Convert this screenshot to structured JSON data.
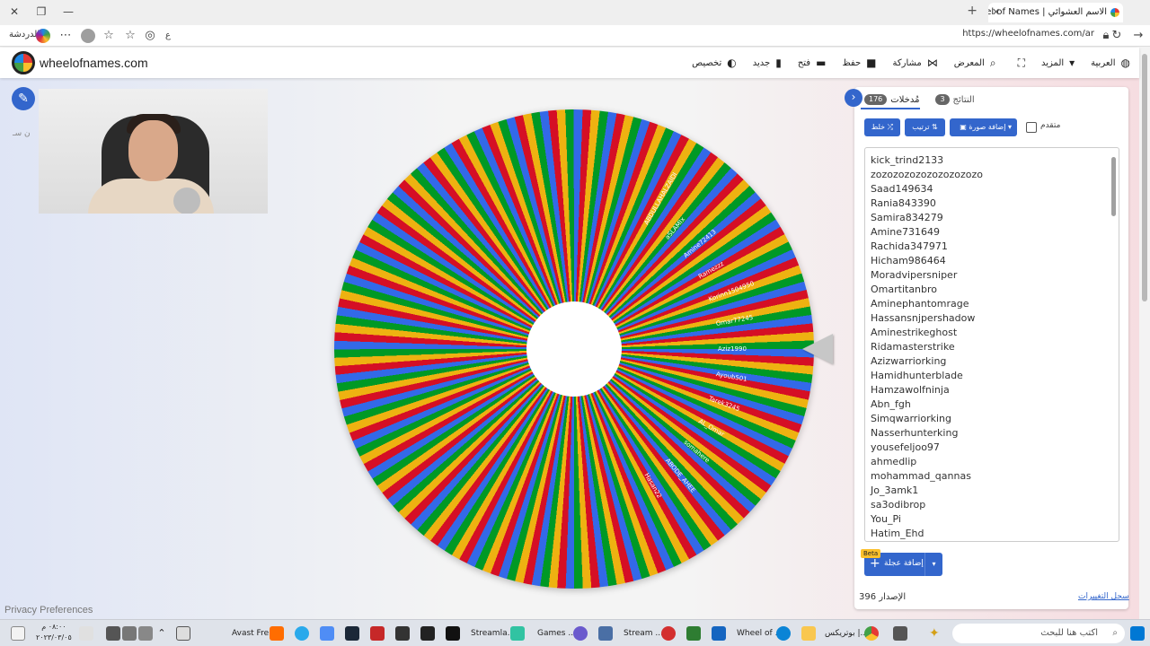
{
  "browser": {
    "tab_title": "الاسم العشوائي | Wheel of Names",
    "url": "https://wheelofnames.com/ar",
    "profile_label": "الدردشة",
    "reader_label": "ع"
  },
  "header": {
    "site_name": "wheelofnames.com",
    "menu": [
      {
        "icon": "palette-icon",
        "label": "تخصيص"
      },
      {
        "icon": "new-file-icon",
        "label": "جديد"
      },
      {
        "icon": "folder-icon",
        "label": "فتح"
      },
      {
        "icon": "save-icon",
        "label": "حفظ"
      },
      {
        "icon": "share-icon",
        "label": "مشاركة"
      },
      {
        "icon": "gallery-icon",
        "label": "المعرض"
      },
      {
        "icon": "fullscreen-icon",
        "label": ""
      },
      {
        "icon": "chevron-down-icon",
        "label": "المزيد"
      },
      {
        "icon": "globe-icon",
        "label": "العربية"
      }
    ]
  },
  "main": {
    "ghost_text": "ن سـ",
    "privacy_link": "Privacy Preferences"
  },
  "wheel": {
    "slice_colors": [
      "#3369e8",
      "#d50f25",
      "#eeb211",
      "#009925"
    ],
    "visible_labels": [
      "ABDULLAHALZAIDI",
      "aSLAMIx",
      "Amine72413",
      "Ramezzz",
      "Korinn1504950",
      "Omar77245",
      "Aziz1990",
      "Ayoub501",
      "Tarek3245",
      "AL_Omar",
      "somahere",
      "ABODE_AHEE",
      "Hasan22"
    ]
  },
  "panel": {
    "tabs": [
      {
        "label": "مُدخلات",
        "count": "176",
        "active": true
      },
      {
        "label": "النتائج",
        "count": "3",
        "active": false
      }
    ],
    "tools": {
      "shuffle": "خلط",
      "sort": "ترتيب",
      "add_image": "إضافة صورة",
      "advanced": "متقدم"
    },
    "entries": [
      "kick_trind2133",
      "zozozozozozozozozozo",
      "Saad149634",
      "Rania843390",
      "Samira834279",
      "Amine731649",
      "Rachida347971",
      "Hicham986464",
      "Moradvipersniper",
      "Omartitanbro",
      "Aminephantomrage",
      "Hassansnjpershadow",
      "Aminestrikeghost",
      "Ridamasterstrike",
      "Azizwarriorking",
      "Hamidhunterblade",
      "Hamzawolfninja",
      "Abn_fgh",
      "Simqwarriorking",
      "Nasserhunterking",
      "yousefeljoo97",
      "ahmedlip",
      "mohammad_qannas",
      "Jo_3amk1",
      "sa3odibrop",
      "You_Pi",
      "Hatim_Ehd"
    ],
    "add_wheel_button": "إضافة عجلة",
    "beta_badge": "Beta",
    "version": "الإصدار 396",
    "changelog_link": "سجل التغييرات"
  },
  "taskbar": {
    "search_placeholder": "اكتب هنا للبحث",
    "clock_time": "٠٨:٠٠ م",
    "clock_date": "٢٠٢٣/٠٣/٠٥",
    "apps": [
      "بوتريكس |...",
      "Wheel of ...",
      "Stream ...",
      "Games ...",
      "Streamla...",
      "Avast Fre..."
    ]
  }
}
